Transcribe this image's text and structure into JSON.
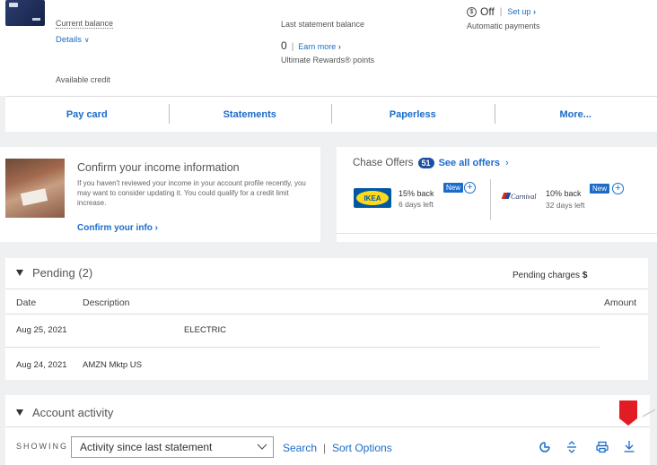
{
  "summary": {
    "current_balance_label": "Current balance",
    "details_link": "Details",
    "last_statement_label": "Last statement balance",
    "rewards_points": "0",
    "earn_more_link": "Earn more",
    "rewards_label": "Ultimate Rewards® points",
    "autopay_status": "Off",
    "setup_link": "Set up",
    "autopay_label": "Automatic payments",
    "available_credit_label": "Available credit"
  },
  "actions": [
    {
      "label": "Pay card"
    },
    {
      "label": "Statements"
    },
    {
      "label": "Paperless"
    },
    {
      "label": "More..."
    }
  ],
  "income_card": {
    "title": "Confirm your income information",
    "body": "If you haven't reviewed your income in your account profile recently, you may want to consider updating it. You could qualify for a credit limit increase.",
    "link": "Confirm your info"
  },
  "offers": {
    "title": "Chase Offers",
    "count": "51",
    "see_all": "See all offers",
    "items": [
      {
        "brand": "IKEA",
        "percent": "15% back",
        "days": "6 days left",
        "badge": "New"
      },
      {
        "brand": "Carnival",
        "percent": "10% back",
        "days": "32 days left",
        "badge": "New"
      }
    ]
  },
  "pending": {
    "title": "Pending (2)",
    "charges_label": "Pending charges",
    "charges_symbol": "$",
    "columns": [
      "Date",
      "Description",
      "Amount"
    ],
    "rows": [
      {
        "date": "Aug 25, 2021",
        "description": "ELECTRIC"
      },
      {
        "date": "Aug 24, 2021",
        "description": "AMZN Mktp US"
      }
    ]
  },
  "activity": {
    "title": "Account activity",
    "showing_label": "SHOWING",
    "selected_filter": "Activity since last statement",
    "search_link": "Search",
    "separator": "|",
    "sort_link": "Sort Options"
  },
  "colors": {
    "link": "#1b6cc9",
    "marker": "#e31b23",
    "background": "#eef0f2"
  }
}
